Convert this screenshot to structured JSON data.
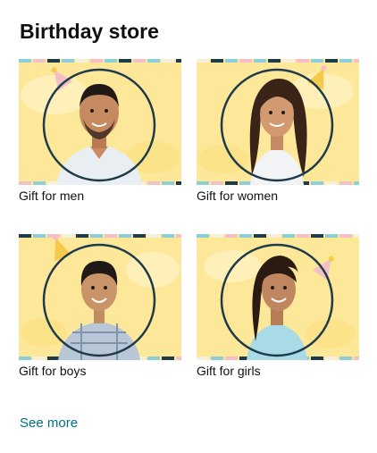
{
  "card": {
    "title": "Birthday store",
    "see_more": "See more",
    "tiles": [
      {
        "label": "Gift for men",
        "icon": "man-portrait-icon"
      },
      {
        "label": "Gift for women",
        "icon": "woman-portrait-icon"
      },
      {
        "label": "Gift for boys",
        "icon": "boy-portrait-icon"
      },
      {
        "label": "Gift for girls",
        "icon": "girl-portrait-icon"
      }
    ]
  },
  "colors": {
    "tile_background": "#fde89a",
    "circle_outline": "#1f3b4a",
    "link": "#007185",
    "stripe_blue": "#8ccfd9",
    "stripe_pink": "#f2c0c5",
    "stripe_navy": "#1f3b4a",
    "stripe_cream": "#f6f0da",
    "party_hat": "#f5c94a"
  }
}
